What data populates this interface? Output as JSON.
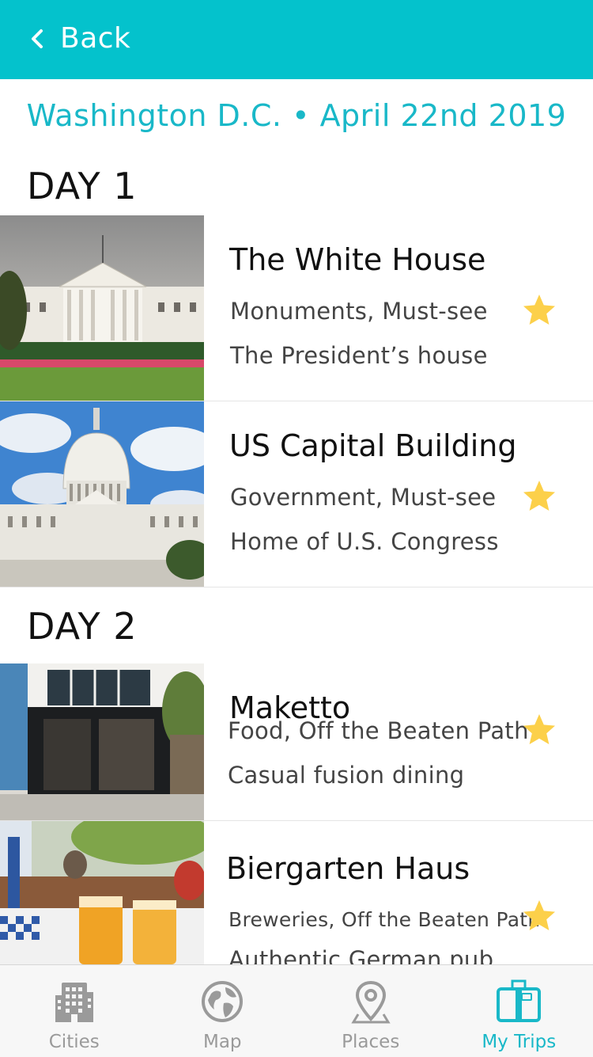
{
  "header": {
    "back_label": "Back"
  },
  "trip": {
    "title": "Washington D.C. • April 22nd 2019"
  },
  "days": [
    {
      "label": "DAY 1",
      "places": [
        {
          "name": "The White House",
          "tags": "Monuments, Must-see",
          "description": "The President’s house",
          "photo": "white-house-photo"
        },
        {
          "name": "US Capital Building",
          "tags": "Government, Must-see",
          "description": "Home of U.S. Congress",
          "photo": "capitol-photo"
        }
      ]
    },
    {
      "label": "DAY 2",
      "places": [
        {
          "name": "Maketto",
          "tags": "Food, Off the Beaten Path",
          "description": "Casual fusion dining",
          "photo": "restaurant-photo"
        },
        {
          "name": "Biergarten Haus",
          "tags": "Breweries, Off the Beaten Path",
          "description": "Authentic German pub",
          "photo": "beer-garden-photo"
        }
      ]
    }
  ],
  "tabs": [
    {
      "label": "Cities",
      "icon": "building-icon",
      "active": false
    },
    {
      "label": "Map",
      "icon": "globe-icon",
      "active": false
    },
    {
      "label": "Places",
      "icon": "location-pin-icon",
      "active": false
    },
    {
      "label": "My Trips",
      "icon": "suitcase-icon",
      "active": true
    }
  ],
  "colors": {
    "accent": "#04c2cc",
    "title_text": "#19b8c8",
    "star": "#fcd04a",
    "tab_inactive": "#9a9a9a"
  }
}
